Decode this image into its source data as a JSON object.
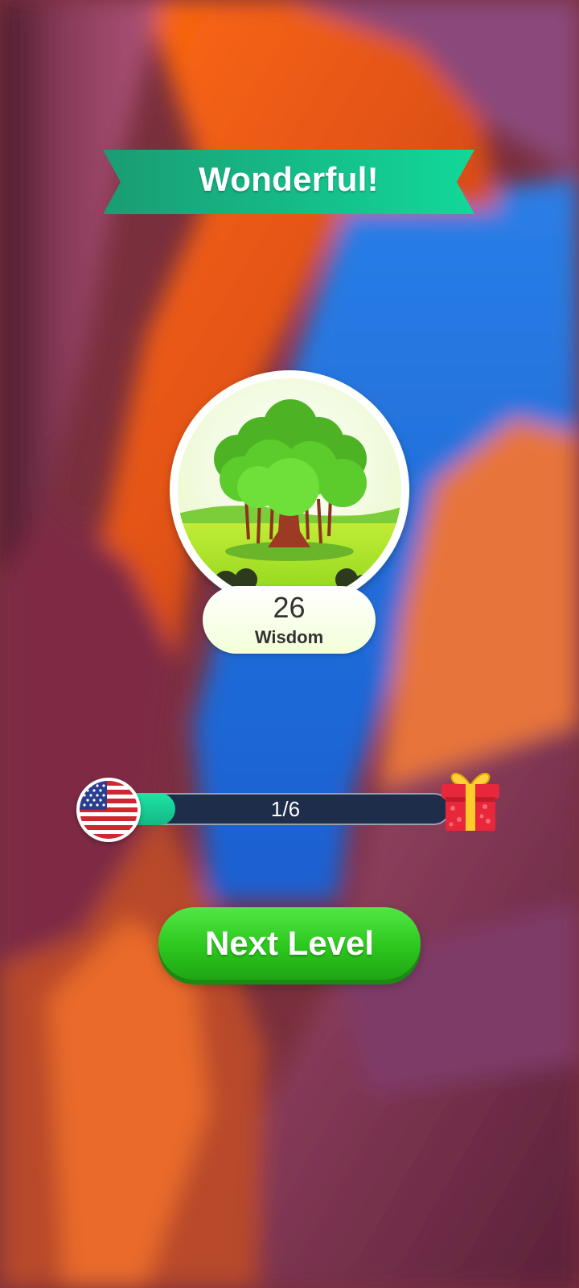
{
  "banner": {
    "title": "Wonderful!"
  },
  "badge": {
    "image": "banyan-tree-icon",
    "score": "26",
    "label": "Wisdom"
  },
  "progress": {
    "text": "1/6",
    "fraction": 0.167,
    "start_icon": "us-flag-icon",
    "end_icon": "gift-box-icon"
  },
  "button": {
    "label": "Next Level"
  },
  "colors": {
    "banner": "#12c48f",
    "button": "#2cc71d",
    "progress_fill": "#18d196",
    "track": "#1d2d4a"
  }
}
